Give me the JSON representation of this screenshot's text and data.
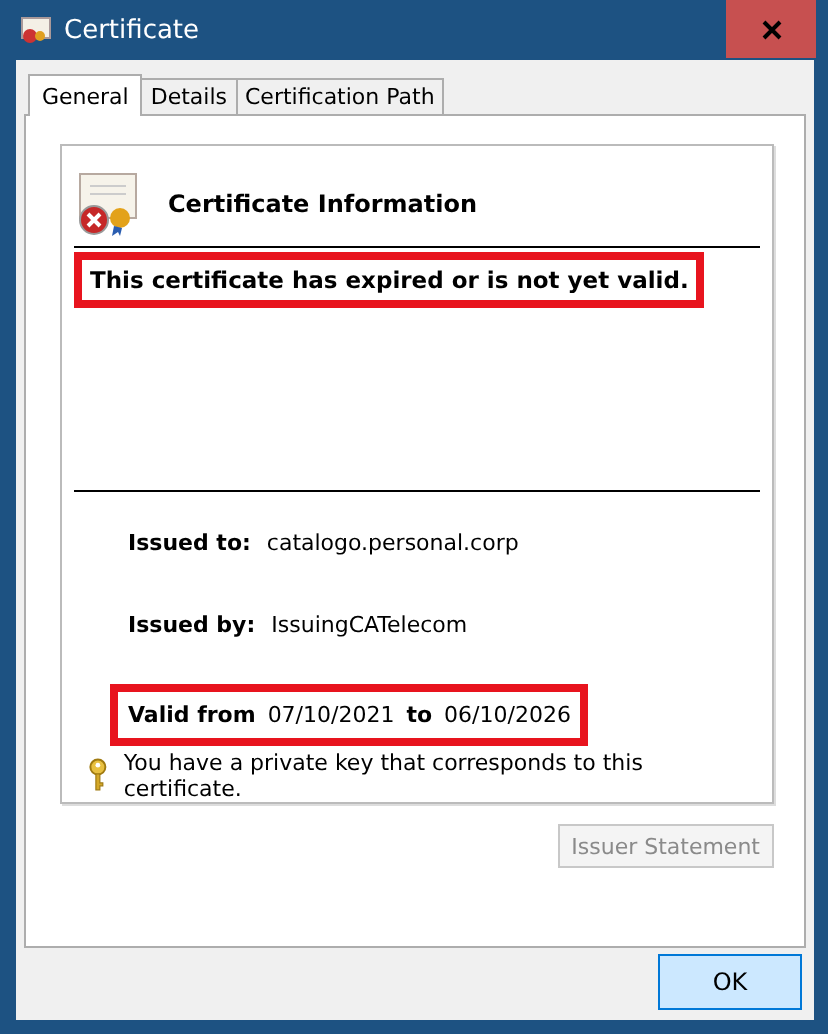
{
  "window": {
    "title": "Certificate"
  },
  "tabs": [
    {
      "label": "General",
      "selected": true
    },
    {
      "label": "Details",
      "selected": false
    },
    {
      "label": "Certification Path",
      "selected": false
    }
  ],
  "info": {
    "heading": "Certificate Information",
    "message": "This certificate has expired or is not yet valid.",
    "message_highlighted": true
  },
  "fields": [
    {
      "label": "Issued to:",
      "value": "catalogo.personal.corp"
    },
    {
      "label": "Issued by:",
      "value": "IssuingCATelecom"
    }
  ],
  "validity": {
    "from_label": "Valid from",
    "from": "07/10/2021",
    "to_label": "to",
    "to": "06/10/2026",
    "highlighted": true
  },
  "private_key_note": "You have a private key that corresponds to this certificate.",
  "issuer_button": {
    "label": "Issuer Statement",
    "disabled": true
  },
  "ok_button": {
    "label": "OK"
  }
}
